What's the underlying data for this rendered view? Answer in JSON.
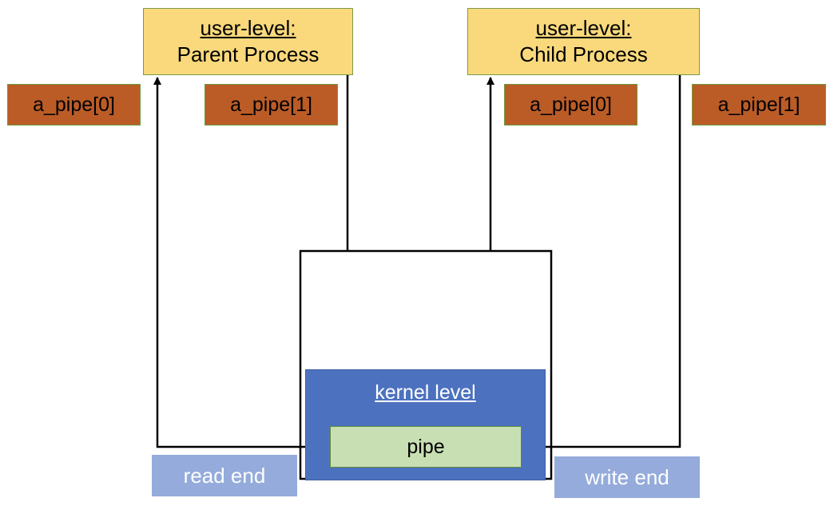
{
  "processes": [
    {
      "level_label": "user-level:",
      "name": "Parent Process"
    },
    {
      "level_label": "user-level:",
      "name": "Child Process"
    }
  ],
  "file_descriptors": {
    "parent": [
      "a_pipe[0]",
      "a_pipe[1]"
    ],
    "child": [
      "a_pipe[0]",
      "a_pipe[1]"
    ]
  },
  "kernel": {
    "label": "kernel level",
    "pipe_label": "pipe"
  },
  "ends": {
    "read": "read end",
    "write": "write end"
  },
  "colors": {
    "process_fill": "#f9d97c",
    "fd_fill": "#bb5c27",
    "kernel_fill": "#4c72bf",
    "pipe_fill": "#c8dfb4",
    "end_label_fill": "#94abdb"
  }
}
